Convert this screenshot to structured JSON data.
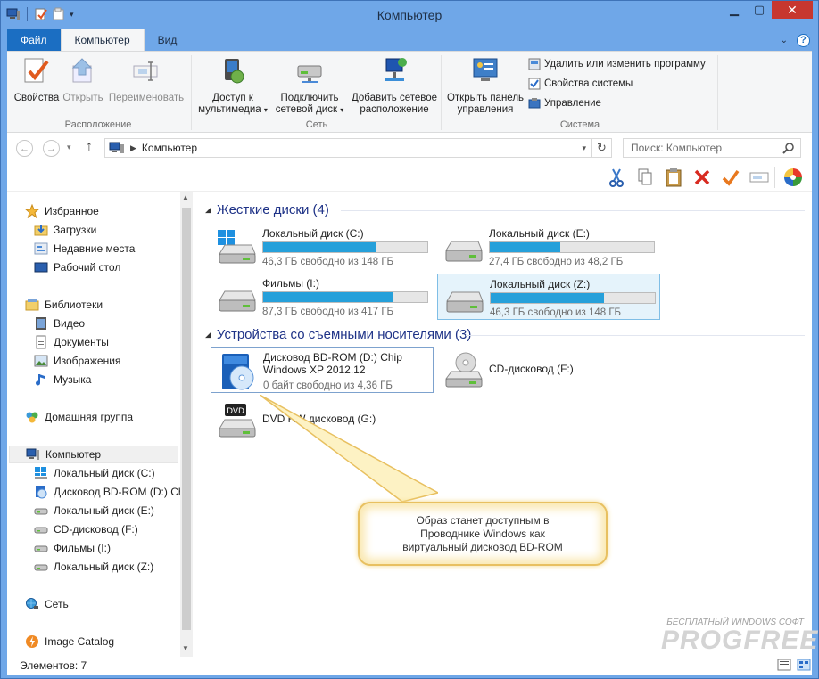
{
  "window": {
    "title": "Компьютер"
  },
  "ribbon_tabs": {
    "file": "Файл",
    "computer": "Компьютер",
    "view": "Вид"
  },
  "ribbon": {
    "location": {
      "label": "Расположение",
      "properties": "Свойства",
      "open": "Открыть",
      "rename": "Переименовать"
    },
    "network": {
      "label": "Сеть",
      "media_line1": "Доступ к",
      "media_line2": "мультимедиа",
      "map_line1": "Подключить",
      "map_line2": "сетевой диск",
      "addloc_line1": "Добавить сетевое",
      "addloc_line2": "расположение"
    },
    "system": {
      "label": "Система",
      "cp_line1": "Открыть панель",
      "cp_line2": "управления",
      "uninstall": "Удалить или изменить программу",
      "sysprops": "Свойства системы",
      "manage": "Управление"
    }
  },
  "address": {
    "path": "Компьютер",
    "search_placeholder": "Поиск: Компьютер"
  },
  "nav": {
    "favorites": "Избранное",
    "downloads": "Загрузки",
    "recent": "Недавние места",
    "desktop": "Рабочий стол",
    "libraries": "Библиотеки",
    "video": "Видео",
    "documents": "Документы",
    "pictures": "Изображения",
    "music": "Музыка",
    "homegroup": "Домашняя группа",
    "computer": "Компьютер",
    "drive_c": "Локальный диск (C:)",
    "drive_d": "Дисковод BD-ROM (D:) Ch",
    "drive_e": "Локальный диск (E:)",
    "drive_f": "CD-дисковод (F:)",
    "drive_i": "Фильмы (I:)",
    "drive_z": "Локальный диск (Z:)",
    "network": "Сеть",
    "image_catalog": "Image Catalog"
  },
  "sections": {
    "hard_disks": "Жесткие диски (4)",
    "removable": "Устройства со съемными носителями (3)"
  },
  "drives": [
    {
      "name": "Локальный диск (C:)",
      "info": "46,3 ГБ свободно из 148 ГБ",
      "used_fraction": 0.69
    },
    {
      "name": "Локальный диск (E:)",
      "info": "27,4 ГБ свободно из 48,2 ГБ",
      "used_fraction": 0.43
    },
    {
      "name": "Фильмы (I:)",
      "info": "87,3 ГБ свободно из 417 ГБ",
      "used_fraction": 0.79
    },
    {
      "name": "Локальный диск (Z:)",
      "info": "46,3 ГБ свободно из 148 ГБ",
      "used_fraction": 0.69
    }
  ],
  "removable": [
    {
      "name_line1": "Дисковод BD-ROM (D:) Chip",
      "name_line2": "Windows XP 2012.12",
      "info": "0 байт свободно из 4,36 ГБ"
    },
    {
      "name": "CD-дисковод (F:)"
    },
    {
      "name": "DVD RW дисковод (G:)"
    }
  ],
  "callout": {
    "line1": "Образ станет доступным в",
    "line2": "Проводнике Windows как",
    "line3": "виртуальный дисковод BD-ROM"
  },
  "status": {
    "count": "Элементов: 7"
  },
  "watermark": {
    "small": "БЕСПЛАТНЫЙ WINDOWS СОФТ",
    "big": "PROGFREE"
  }
}
